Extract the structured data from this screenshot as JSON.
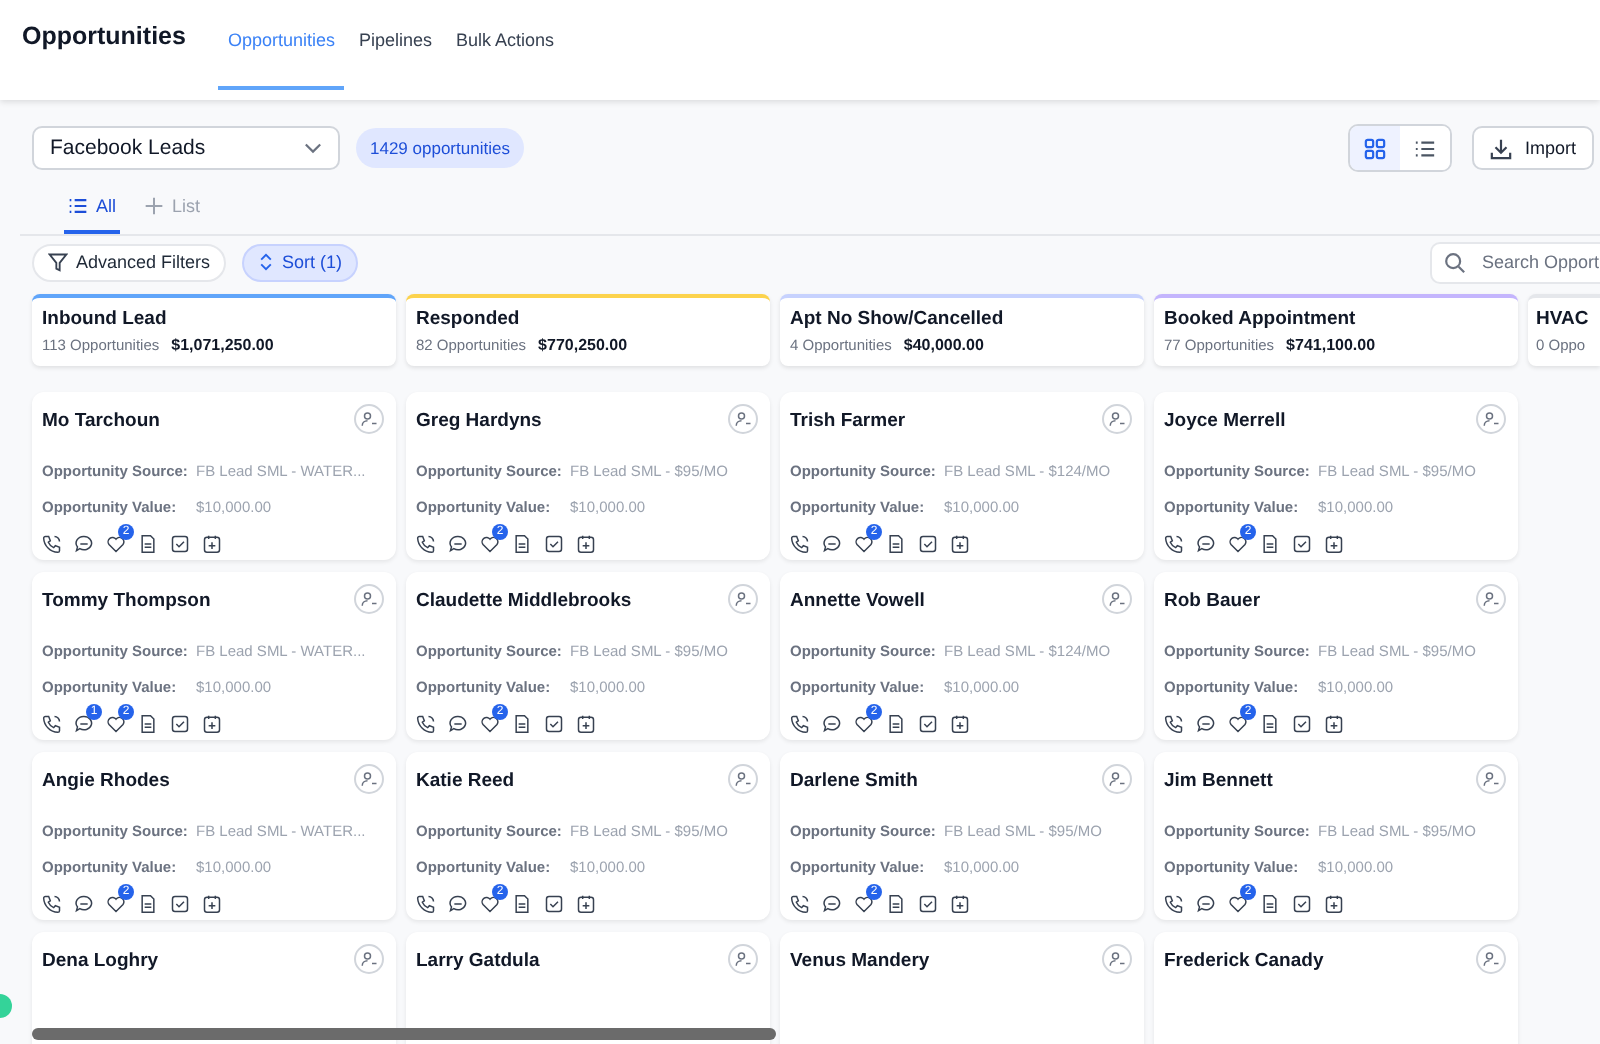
{
  "header": {
    "title": "Opportunities",
    "tabs": [
      {
        "label": "Opportunities",
        "selected": true
      },
      {
        "label": "Pipelines",
        "selected": false
      },
      {
        "label": "Bulk Actions",
        "selected": false
      }
    ]
  },
  "toolbar": {
    "pipeline": "Facebook Leads",
    "count": "1429 opportunities",
    "views": [
      {
        "kind": "grid",
        "selected": true
      },
      {
        "kind": "list",
        "selected": false
      }
    ],
    "import": "Import"
  },
  "list_tabs": [
    {
      "kind": "list",
      "label": "All",
      "selected": true
    },
    {
      "kind": "add",
      "label": "List",
      "selected": false
    }
  ],
  "filters": {
    "advanced": "Advanced Filters",
    "sort": "Sort (1)",
    "search_placeholder": "Search Opport"
  },
  "stages": [
    {
      "name": "Inbound Lead",
      "count": "113 Opportunities",
      "total": "$1,071,250.00",
      "color": "#60a5fa",
      "cards": [
        {
          "name": "Mo Tarchoun",
          "source_label": "Opportunity Source:",
          "source": "FB Lead SML - WATER...",
          "value_label": "Opportunity Value:",
          "value": "$10,000.00",
          "heart_badge": "2"
        },
        {
          "name": "Tommy Thompson",
          "source_label": "Opportunity Source:",
          "source": "FB Lead SML - WATER...",
          "value_label": "Opportunity Value:",
          "value": "$10,000.00",
          "chat_badge": "1",
          "heart_badge": "2"
        },
        {
          "name": "Angie Rhodes",
          "source_label": "Opportunity Source:",
          "source": "FB Lead SML - WATER...",
          "value_label": "Opportunity Value:",
          "value": "$10,000.00",
          "heart_badge": "2"
        },
        {
          "name": "Dena Loghry"
        }
      ]
    },
    {
      "name": "Responded",
      "count": "82 Opportunities",
      "total": "$770,250.00",
      "color": "#fcd34d",
      "cards": [
        {
          "name": "Greg Hardyns",
          "source_label": "Opportunity Source:",
          "source": "FB Lead SML - $95/MO",
          "value_label": "Opportunity Value:",
          "value": "$10,000.00",
          "heart_badge": "2"
        },
        {
          "name": "Claudette Middlebrooks",
          "source_label": "Opportunity Source:",
          "source": "FB Lead SML - $95/MO",
          "value_label": "Opportunity Value:",
          "value": "$10,000.00",
          "heart_badge": "2"
        },
        {
          "name": "Katie Reed",
          "source_label": "Opportunity Source:",
          "source": "FB Lead SML - $95/MO",
          "value_label": "Opportunity Value:",
          "value": "$10,000.00",
          "heart_badge": "2"
        },
        {
          "name": "Larry Gatdula"
        }
      ]
    },
    {
      "name": "Apt No Show/Cancelled",
      "count": "4 Opportunities",
      "total": "$40,000.00",
      "color": "#c7d2fe",
      "cards": [
        {
          "name": "Trish Farmer",
          "source_label": "Opportunity Source:",
          "source": "FB Lead SML - $124/MO",
          "value_label": "Opportunity Value:",
          "value": "$10,000.00",
          "heart_badge": "2"
        },
        {
          "name": "Annette Vowell",
          "source_label": "Opportunity Source:",
          "source": "FB Lead SML - $124/MO",
          "value_label": "Opportunity Value:",
          "value": "$10,000.00",
          "heart_badge": "2"
        },
        {
          "name": "Darlene Smith",
          "source_label": "Opportunity Source:",
          "source": "FB Lead SML - $95/MO",
          "value_label": "Opportunity Value:",
          "value": "$10,000.00",
          "heart_badge": "2"
        },
        {
          "name": "Venus Mandery"
        }
      ]
    },
    {
      "name": "Booked Appointment",
      "count": "77 Opportunities",
      "total": "$741,100.00",
      "color": "#c4b5fd",
      "cards": [
        {
          "name": "Joyce Merrell",
          "source_label": "Opportunity Source:",
          "source": "FB Lead SML - $95/MO",
          "value_label": "Opportunity Value:",
          "value": "$10,000.00",
          "heart_badge": "2"
        },
        {
          "name": "Rob Bauer",
          "source_label": "Opportunity Source:",
          "source": "FB Lead SML - $95/MO",
          "value_label": "Opportunity Value:",
          "value": "$10,000.00",
          "heart_badge": "2"
        },
        {
          "name": "Jim Bennett",
          "source_label": "Opportunity Source:",
          "source": "FB Lead SML - $95/MO",
          "value_label": "Opportunity Value:",
          "value": "$10,000.00",
          "heart_badge": "2"
        },
        {
          "name": "Frederick Canady"
        }
      ]
    },
    {
      "name": "HVAC",
      "count": "0 Oppo",
      "color": "#e5e7eb"
    }
  ]
}
